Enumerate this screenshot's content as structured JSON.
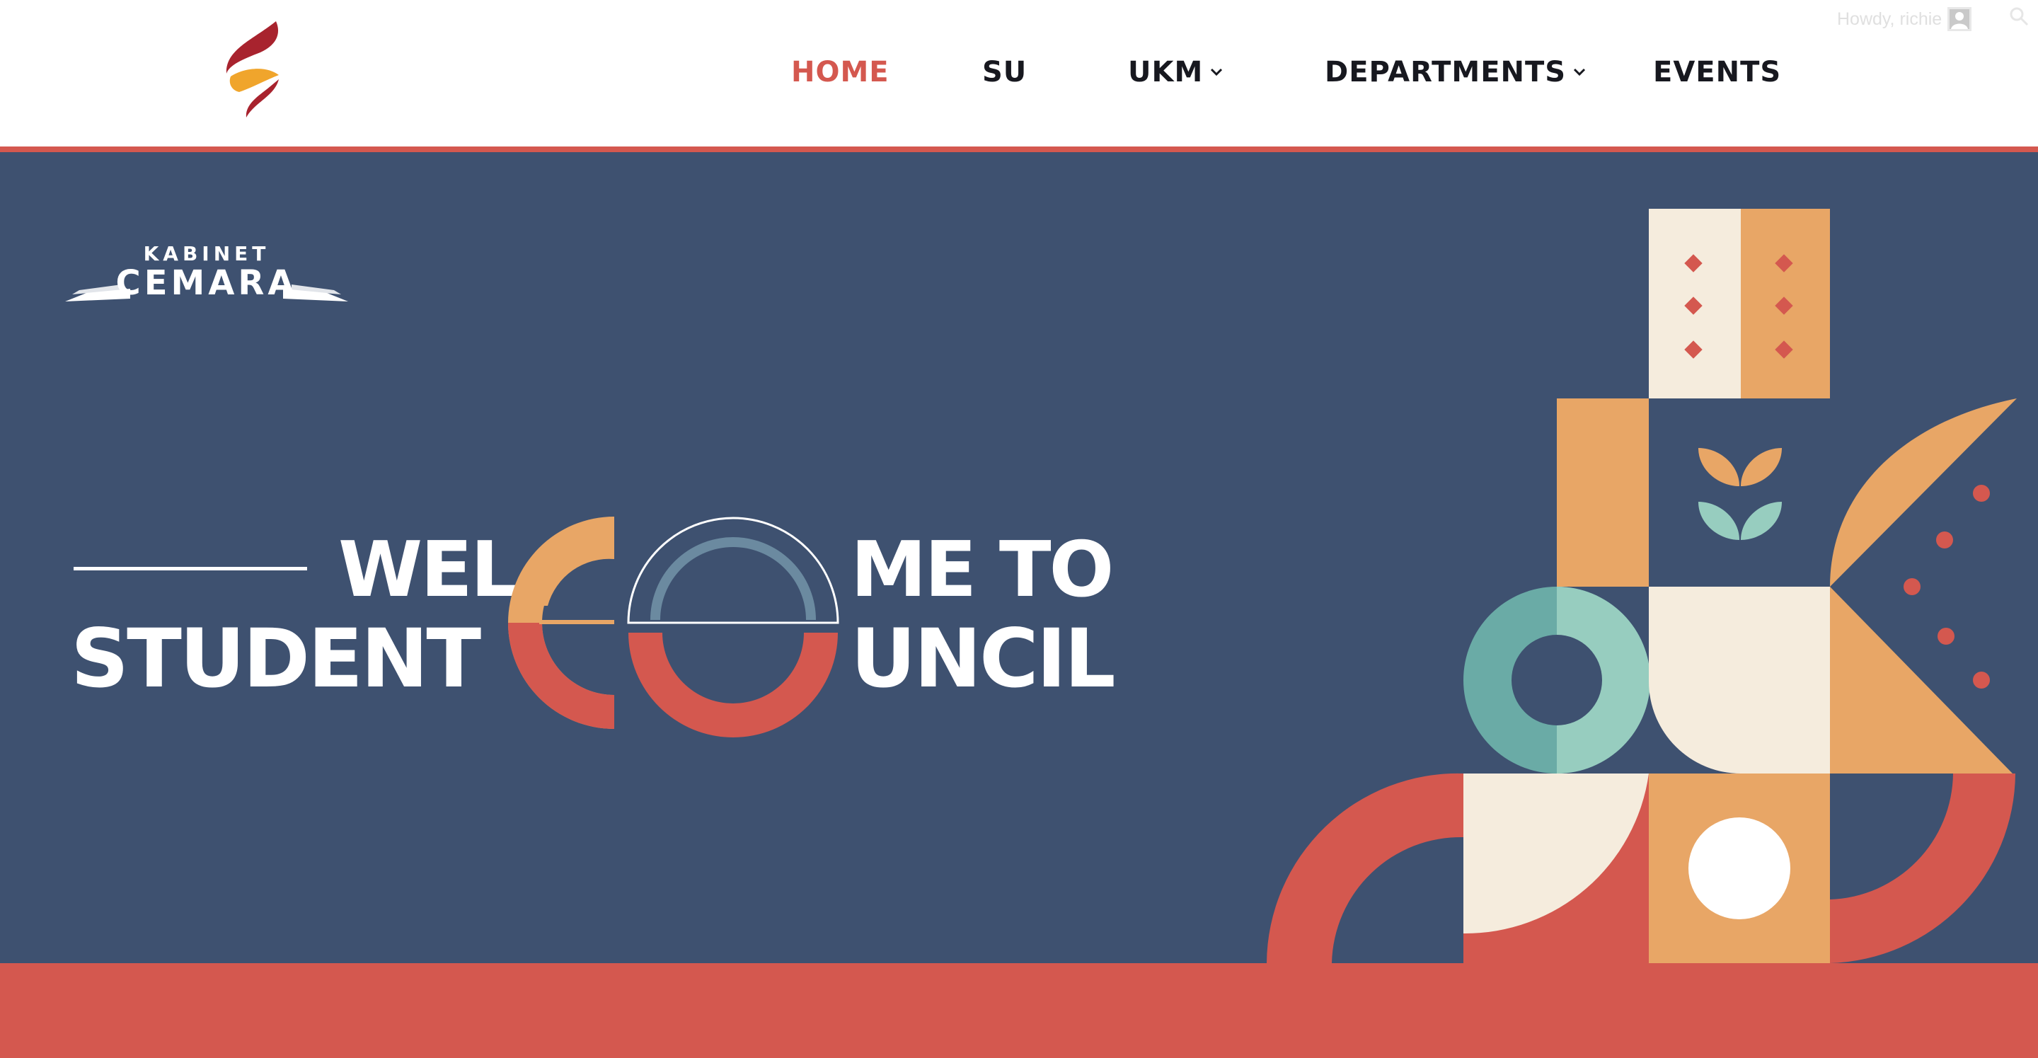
{
  "header": {
    "logo_icon": "flame-s-logo",
    "nav": [
      {
        "label": "HOME",
        "active": true,
        "has_dropdown": false
      },
      {
        "label": "SU",
        "active": false,
        "has_dropdown": false
      },
      {
        "label": "UKM",
        "active": false,
        "has_dropdown": true
      },
      {
        "label": "DEPARTMENTS",
        "active": false,
        "has_dropdown": true
      },
      {
        "label": "EVENTS",
        "active": false,
        "has_dropdown": false
      }
    ],
    "admin": {
      "greeting": "Howdy, richie",
      "avatar_icon": "user-avatar-icon",
      "search_icon": "search-icon"
    }
  },
  "hero": {
    "brand": {
      "top": "KABINET",
      "main": "CEMARA"
    },
    "headline": {
      "wel": "WEL",
      "student": "STUDENT",
      "me_to": "ME TO",
      "uncil": "UNCIL"
    },
    "colors": {
      "navy": "#3e5170",
      "coral": "#d4584f",
      "orange": "#e8a666",
      "cream": "#f5ecdd",
      "teal": "#6aaba6",
      "mint": "#97cdbf"
    }
  }
}
